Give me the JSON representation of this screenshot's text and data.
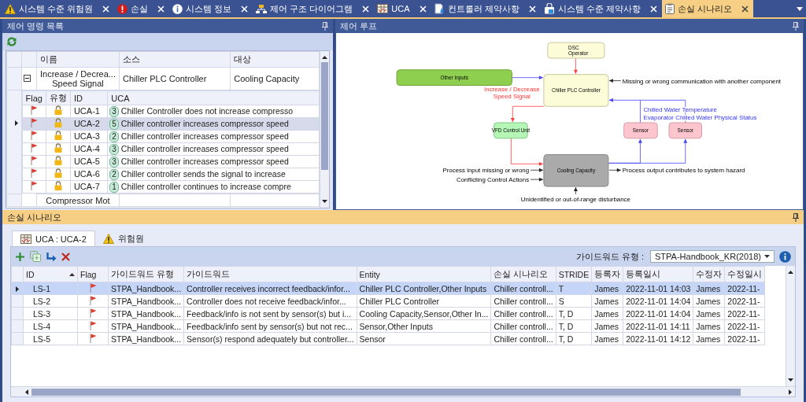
{
  "document_tabs": [
    {
      "label": "시스템 수준 위험원",
      "selected": false
    },
    {
      "label": "손실",
      "selected": false
    },
    {
      "label": "시스템 정보",
      "selected": false
    },
    {
      "label": "제어 구조 다이어그램",
      "selected": false
    },
    {
      "label": "UCA",
      "selected": false
    },
    {
      "label": "컨트롤러 제약사항",
      "selected": false
    },
    {
      "label": "시스템 수준 제약사항",
      "selected": false
    },
    {
      "label": "손실 시나리오",
      "selected": true
    }
  ],
  "control_actions": {
    "title": "제어 명령 목록",
    "columns": [
      "이름",
      "소스",
      "대상"
    ],
    "rows": [
      {
        "name_lines": [
          "Increase / Decrea...",
          "Speed Signal"
        ],
        "source": "Chiller PLC Controller",
        "target": "Cooling Capacity",
        "expanded": true,
        "uca_columns": [
          "Flag",
          "유형",
          "ID",
          "UCA"
        ],
        "ucas": [
          {
            "id": "UCA-1",
            "count": "3",
            "text": "Chiller Controller does not increase compresso",
            "selected": false
          },
          {
            "id": "UCA-2",
            "count": "5",
            "text": "Chiller controller increases compressor speed",
            "selected": true
          },
          {
            "id": "UCA-3",
            "count": "2",
            "text": "Chiller controller increases compressor speed",
            "selected": false
          },
          {
            "id": "UCA-4",
            "count": "3",
            "text": "Chiller controller increases compressor speed",
            "selected": false
          },
          {
            "id": "UCA-5",
            "count": "3",
            "text": "Chiller controller increases compressor speed",
            "selected": false
          },
          {
            "id": "UCA-6",
            "count": "2",
            "text": "Chiller controller sends the signal to increase",
            "selected": false
          },
          {
            "id": "UCA-7",
            "count": "1",
            "text": "Chiller controller continues to increase compre",
            "selected": false
          }
        ]
      },
      {
        "name_lines": [
          "Compressor Mot"
        ],
        "source": "",
        "target": ""
      }
    ]
  },
  "control_loop": {
    "title": "제어 루프",
    "nodes": [
      {
        "kind": "operator",
        "lines": [
          "DSC",
          "Operator"
        ]
      },
      {
        "kind": "input",
        "lines": [
          "Other Inputs"
        ]
      },
      {
        "kind": "controller",
        "lines": [
          "Chiller PLC Controller"
        ]
      },
      {
        "kind": "actuator",
        "lines": [
          "VFD Control Unit"
        ]
      },
      {
        "kind": "sensor",
        "lines": [
          "Sensor"
        ]
      },
      {
        "kind": "sensor",
        "lines": [
          "Sensor"
        ]
      },
      {
        "kind": "process",
        "lines": [
          "Cooling Capacity"
        ]
      }
    ],
    "control_label": [
      "Increase / Decrease",
      "Speed Signal"
    ],
    "feedback_labels": [
      "Chilled Water Temperature",
      "Evaporator Chilled Water Physical Status"
    ],
    "annotations": [
      "Missing or wrong communication with another component",
      "Process input missing or wrong",
      "Conflicting Control Actions",
      "Process output contributes to system hazard",
      "Unidentified or out-of-range disturbance"
    ]
  },
  "loss_scenarios": {
    "title": "손실 시나리오",
    "tabs": [
      {
        "label": "UCA : UCA-2",
        "selected": true
      },
      {
        "label": "위험원",
        "selected": false
      }
    ],
    "guideword_label": "가이드워드 유형 :",
    "guideword_value": "STPA-Handbook_KR(2018)",
    "columns": [
      "ID",
      "Flag",
      "가이드워드 유형",
      "가이드워드",
      "Entity",
      "손실 시나리오",
      "STRIDE",
      "등록자",
      "등록일시",
      "수정자",
      "수정일시"
    ],
    "rows": [
      {
        "id": "LS-1",
        "guideword_type": "STPA_Handbook...",
        "guideword": "Controller receives incorrect feedback/infor...",
        "entity": "Chiller PLC Controller,Other Inputs",
        "scenario": "Chiller controll...",
        "stride": "T",
        "author": "James",
        "created": "2022-11-01 14:03",
        "editor": "James",
        "modified": "2022-11-",
        "selected": true
      },
      {
        "id": "LS-2",
        "guideword_type": "STPA_Handbook...",
        "guideword": "Controller does not receive feedback/infor...",
        "entity": "Chiller PLC Controller",
        "scenario": "Chiller controll...",
        "stride": "S",
        "author": "James",
        "created": "2022-11-01 14:04",
        "editor": "James",
        "modified": "2022-11-",
        "selected": false
      },
      {
        "id": "LS-3",
        "guideword_type": "STPA_Handbook...",
        "guideword": "Feedback/info is not sent by sensor(s) but i...",
        "entity": "Cooling Capacity,Sensor,Other In...",
        "scenario": "Chiller controll...",
        "stride": "T, D",
        "author": "James",
        "created": "2022-11-01 14:04",
        "editor": "James",
        "modified": "2022-11-",
        "selected": false
      },
      {
        "id": "LS-4",
        "guideword_type": "STPA_Handbook...",
        "guideword": "Feedback/info sent by sensor(s) but not rec...",
        "entity": "Sensor,Other Inputs",
        "scenario": "Chiller controll...",
        "stride": "T, D",
        "author": "James",
        "created": "2022-11-01 14:11",
        "editor": "James",
        "modified": "2022-11-",
        "selected": false
      },
      {
        "id": "LS-5",
        "guideword_type": "STPA_Handbook...",
        "guideword": "Sensor(s) respond adequately but controller...",
        "entity": "Sensor",
        "scenario": "Chiller controll...",
        "stride": "T, D",
        "author": "James",
        "created": "2022-11-01 14:12",
        "editor": "James",
        "modified": "2022-11-",
        "selected": false
      }
    ]
  }
}
